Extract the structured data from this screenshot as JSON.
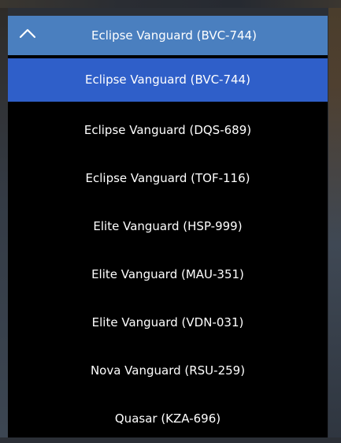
{
  "dropdown": {
    "selected_label": "Eclipse Vanguard (BVC-744)",
    "collapse_icon": "chevron-up-icon",
    "options": [
      "Eclipse Vanguard (BVC-744)",
      "Eclipse Vanguard (DQS-689)",
      "Eclipse Vanguard (TOF-116)",
      "Elite Vanguard (HSP-999)",
      "Elite Vanguard (MAU-351)",
      "Elite Vanguard (VDN-031)",
      "Nova Vanguard (RSU-259)",
      "Quasar (KZA-696)"
    ],
    "selected_index": 0
  },
  "colors": {
    "header_bg": "#4a7fbf",
    "selected_bg": "#2f5fc9",
    "list_bg": "#000000",
    "text": "#ffffff"
  }
}
